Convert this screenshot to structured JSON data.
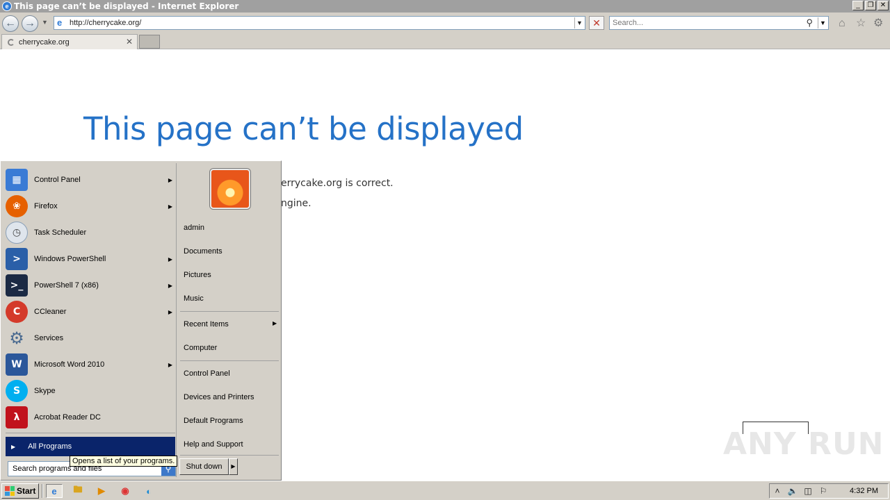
{
  "window": {
    "title": "This page can’t be displayed - Internet Explorer",
    "controls": {
      "minimize": "_",
      "restore": "❐",
      "close": "✕"
    }
  },
  "navbar": {
    "back_icon": "back-arrow-icon",
    "forward_icon": "forward-arrow-icon",
    "address_url": "http://cherrycake.org/",
    "search_placeholder": "Search...",
    "icons": [
      "home-icon",
      "favorites-star-icon",
      "settings-gear-icon"
    ]
  },
  "tab": {
    "label": "cherrycake.org"
  },
  "page": {
    "heading": "This page can’t be displayed",
    "line1_visible": "errycake.org is correct.",
    "line2_visible": "ngine."
  },
  "start_menu": {
    "programs": [
      {
        "label": "Control Panel",
        "icon": "control-panel-icon",
        "color": "#3a7bd5",
        "submenu": true
      },
      {
        "label": "Firefox",
        "icon": "firefox-icon",
        "color": "#e66000",
        "submenu": true
      },
      {
        "label": "Task Scheduler",
        "icon": "task-scheduler-icon",
        "color": "#8aa0b8",
        "submenu": false
      },
      {
        "label": "Windows PowerShell",
        "icon": "powershell-icon",
        "color": "#2a5fa8",
        "submenu": true
      },
      {
        "label": "PowerShell 7 (x86)",
        "icon": "powershell7-icon",
        "color": "#1b2a44",
        "submenu": true
      },
      {
        "label": "CCleaner",
        "icon": "ccleaner-icon",
        "color": "#d43a2a",
        "submenu": true
      },
      {
        "label": "Services",
        "icon": "services-gear-icon",
        "color": "#6a8ab0",
        "submenu": false
      },
      {
        "label": "Microsoft Word 2010",
        "icon": "word-icon",
        "color": "#2b579a",
        "submenu": true
      },
      {
        "label": "Skype",
        "icon": "skype-icon",
        "color": "#00aff0",
        "submenu": false
      },
      {
        "label": "Acrobat Reader DC",
        "icon": "acrobat-icon",
        "color": "#c1121c",
        "submenu": false
      }
    ],
    "all_programs": "All Programs",
    "search_value": "Search programs and files",
    "tooltip": "Opens a list of your programs.",
    "right_items": {
      "user": "admin",
      "documents": "Documents",
      "pictures": "Pictures",
      "music": "Music",
      "recent_items": "Recent Items",
      "computer": "Computer",
      "control_panel": "Control Panel",
      "devices_printers": "Devices and Printers",
      "default_programs": "Default Programs",
      "help_support": "Help and Support"
    },
    "shutdown": "Shut down"
  },
  "taskbar": {
    "start": "Start",
    "quick_launch": [
      "internet-explorer-icon",
      "file-explorer-icon",
      "media-player-icon",
      "chrome-icon",
      "edge-icon"
    ],
    "tray_icons": [
      "show-hidden-icons-icon",
      "volume-icon",
      "network-icon",
      "action-center-flag-icon"
    ],
    "clock": "4:32 PM"
  },
  "watermark": "ANY RUN"
}
